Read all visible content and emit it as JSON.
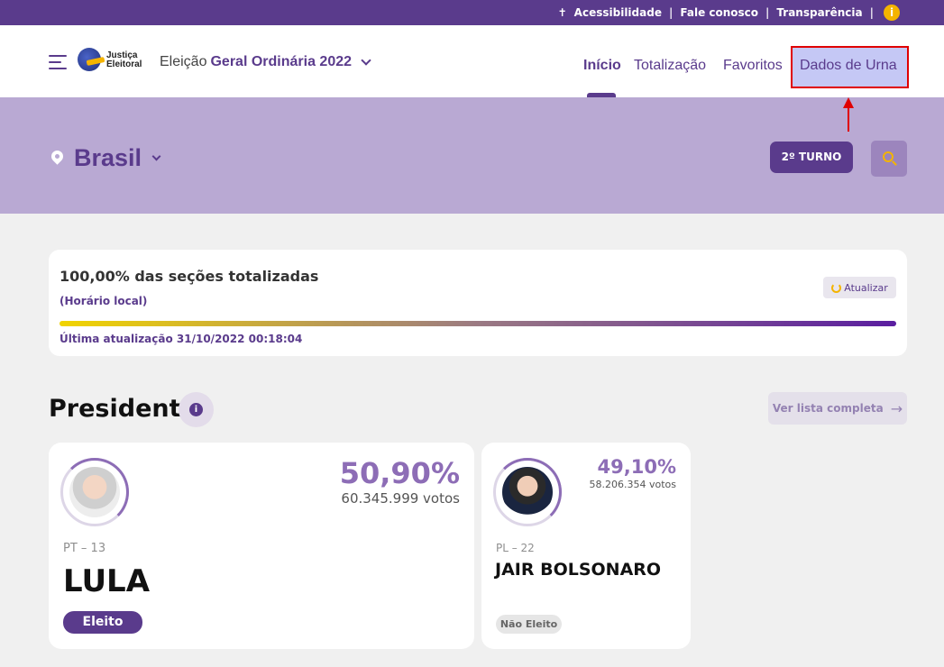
{
  "topbar": {
    "accessibility": "Acessibilidade",
    "contact": "Fale conosco",
    "transparency": "Transparência",
    "separator": "|",
    "info_glyph": "i"
  },
  "header": {
    "logo_line1": "Justiça",
    "logo_line2": "Eleitoral",
    "election_prefix": "Eleição",
    "election_name": "Geral Ordinária 2022",
    "nav": [
      "Início",
      "Totalização",
      "Favoritos",
      "Dados de Urna"
    ]
  },
  "location": {
    "name": "Brasil",
    "round_button": "2º TURNO"
  },
  "status": {
    "title": "100,00% das seções totalizadas",
    "subtitle": "(Horário local)",
    "refresh": "Atualizar",
    "progress": 1.0,
    "last_update": "Última atualização 31/10/2022 00:18:04"
  },
  "section": {
    "title": "Presidente",
    "info_glyph": "i",
    "see_all": "Ver lista completa",
    "see_all_arrow": "→"
  },
  "candidates": [
    {
      "party": "PT – 13",
      "name": "LULA",
      "percent": "50,90%",
      "votes": "60.345.999 votos",
      "status": "Eleito"
    },
    {
      "party": "PL – 22",
      "name": "JAIR BOLSONARO",
      "percent": "49,10%",
      "votes": "58.206.354 votos",
      "status": "Não Eleito"
    }
  ],
  "colors": {
    "brand_purple": "#5a3b8c",
    "band": "#b9a9d3",
    "accent_yellow": "#f4b400",
    "highlight_outline": "#e00000"
  }
}
